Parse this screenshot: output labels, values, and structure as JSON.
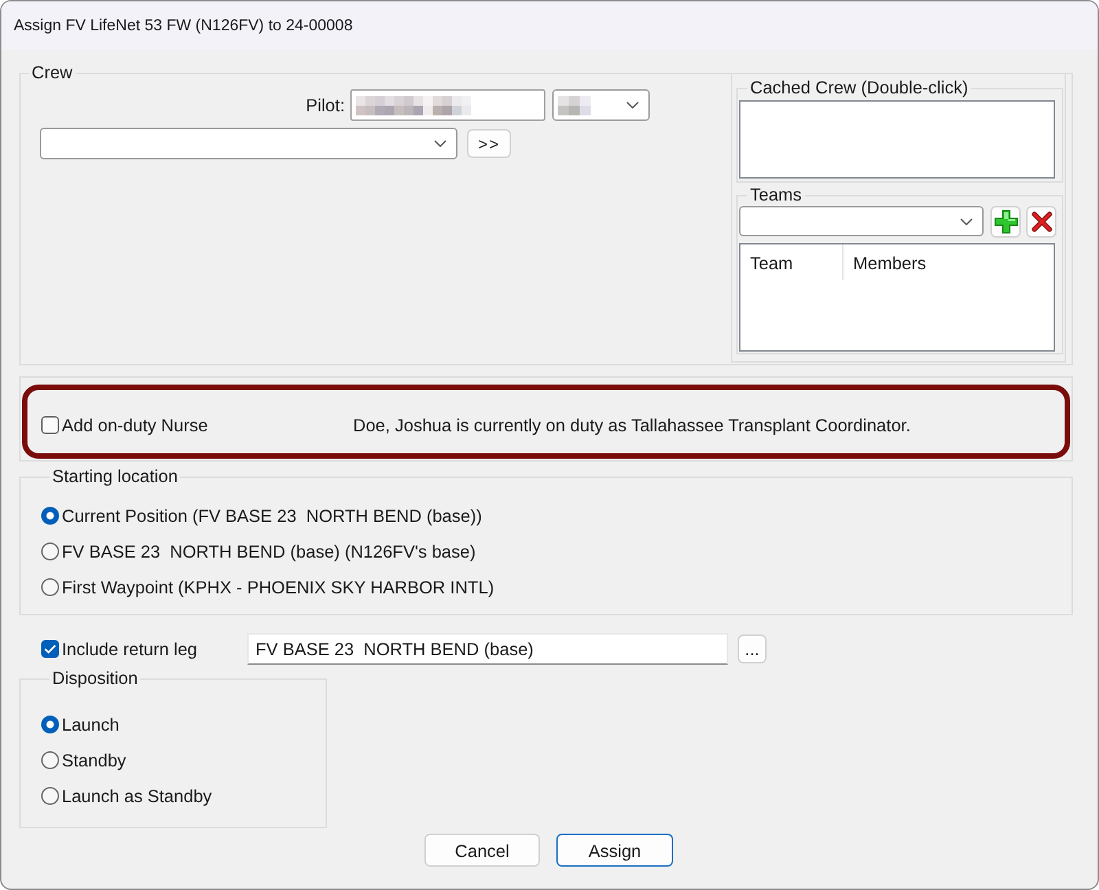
{
  "window": {
    "title": "Assign FV LifeNet 53 FW (N126FV) to 24-00008"
  },
  "crew": {
    "title": "Crew",
    "pilot": {
      "label": "Pilot:",
      "name_redacted": true,
      "shift_redacted": true
    },
    "add_button": {
      "label": ">>"
    },
    "cached_crew": {
      "title": "Cached Crew (Double-click)"
    },
    "teams": {
      "title": "Teams",
      "columns": [
        "Team",
        "Members"
      ]
    }
  },
  "nurse_notice": {
    "highlighted": true,
    "checkbox": {
      "label": "Add on-duty Nurse",
      "checked": false
    },
    "message": "Doe, Joshua is currently on duty as Tallahassee Transplant Coordinator."
  },
  "starting_location": {
    "title": "Starting location",
    "options": [
      {
        "label": "Current Position (FV BASE 23  NORTH BEND (base))",
        "selected": true
      },
      {
        "label": "FV BASE 23  NORTH BEND (base) (N126FV's base)",
        "selected": false
      },
      {
        "label": "First Waypoint (KPHX - PHOENIX SKY HARBOR INTL)",
        "selected": false
      }
    ]
  },
  "return_leg": {
    "label": "Include return leg",
    "checked": true,
    "value": "FV BASE 23  NORTH BEND (base)",
    "browse_button": "..."
  },
  "disposition": {
    "title": "Disposition",
    "options": [
      {
        "label": "Launch",
        "selected": true
      },
      {
        "label": "Standby",
        "selected": false
      },
      {
        "label": "Launch as Standby",
        "selected": false
      }
    ]
  },
  "buttons": [
    {
      "label": "Cancel",
      "default": false
    },
    {
      "label": "Assign",
      "default": true
    }
  ]
}
